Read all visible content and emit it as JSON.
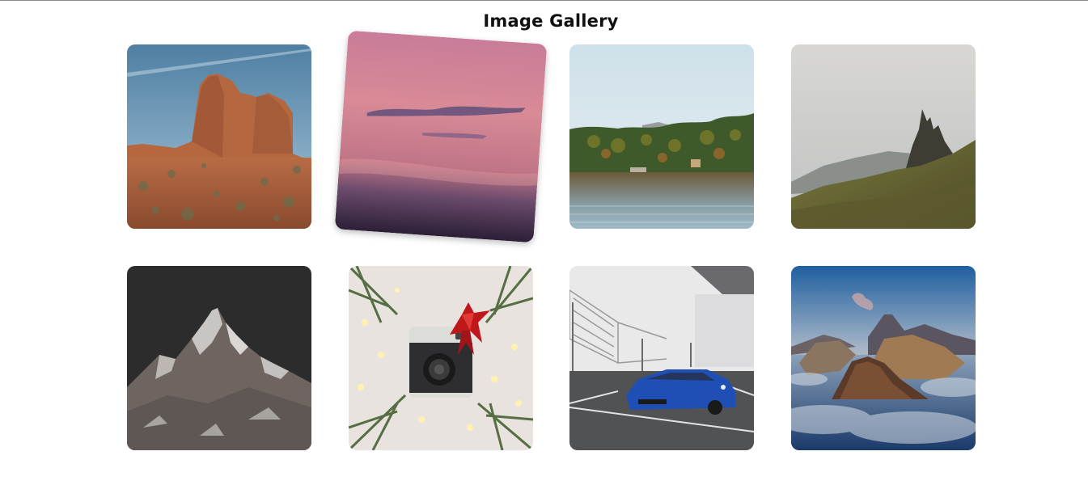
{
  "page": {
    "title": "Image Gallery"
  },
  "gallery": {
    "images": [
      {
        "subject": "desert-rock-formation"
      },
      {
        "subject": "pink-sunset-sky",
        "state": "hovered"
      },
      {
        "subject": "lake-with-forest"
      },
      {
        "subject": "rocky-mountain-pinnacles"
      },
      {
        "subject": "snowy-mountain-peak"
      },
      {
        "subject": "instant-camera-with-bow"
      },
      {
        "subject": "blue-sports-car-parking"
      },
      {
        "subject": "volcano-above-clouds"
      }
    ]
  },
  "colors": {
    "background": "#ffffff",
    "title_text": "#111111"
  }
}
